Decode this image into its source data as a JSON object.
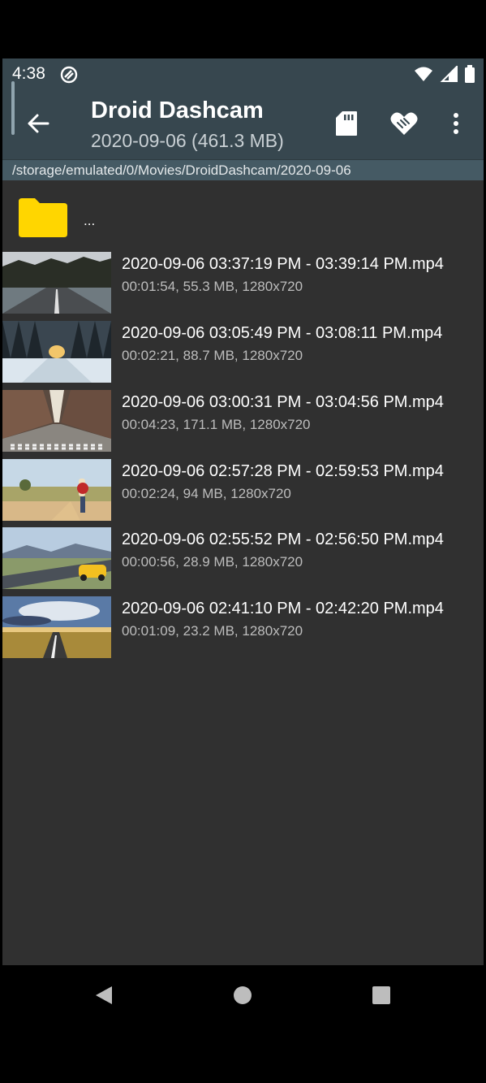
{
  "status_bar": {
    "time": "4:38",
    "left_icon": "sync-icon",
    "right_icons": [
      "wifi-icon",
      "signal-icon",
      "battery-icon"
    ]
  },
  "app_bar": {
    "title": "Droid Dashcam",
    "subtitle": "2020-09-06 (461.3 MB)",
    "actions": [
      "sd-card-icon",
      "handshake-icon",
      "more-vert-icon"
    ]
  },
  "path": "/storage/emulated/0/Movies/DroidDashcam/2020-09-06",
  "parent_entry": {
    "label": "...",
    "icon": "folder-icon"
  },
  "files": [
    {
      "name": "2020-09-06 03:37:19 PM - 03:39:14 PM.mp4",
      "meta": "00:01:54, 55.3 MB, 1280x720",
      "thumb": "road-forest"
    },
    {
      "name": "2020-09-06 03:05:49 PM - 03:08:11 PM.mp4",
      "meta": "00:02:21, 88.7 MB, 1280x720",
      "thumb": "snow-forest"
    },
    {
      "name": "2020-09-06 03:00:31 PM - 03:04:56 PM.mp4",
      "meta": "00:04:23, 171.1 MB, 1280x720",
      "thumb": "city-crosswalk"
    },
    {
      "name": "2020-09-06 02:57:28 PM - 02:59:53 PM.mp4",
      "meta": "00:02:24, 94 MB, 1280x720",
      "thumb": "field-walker"
    },
    {
      "name": "2020-09-06 02:55:52 PM - 02:56:50 PM.mp4",
      "meta": "00:00:56, 28.9 MB, 1280x720",
      "thumb": "highway-car"
    },
    {
      "name": "2020-09-06 02:41:10 PM - 02:42:20 PM.mp4",
      "meta": "00:01:09, 23.2 MB, 1280x720",
      "thumb": "sunset-road"
    }
  ],
  "nav_bar": [
    "back-nav-icon",
    "home-nav-icon",
    "recents-nav-icon"
  ],
  "colors": {
    "app_bar": "#37474f",
    "path_bar": "#455a64",
    "content_bg": "#303030",
    "folder": "#ffd600"
  }
}
